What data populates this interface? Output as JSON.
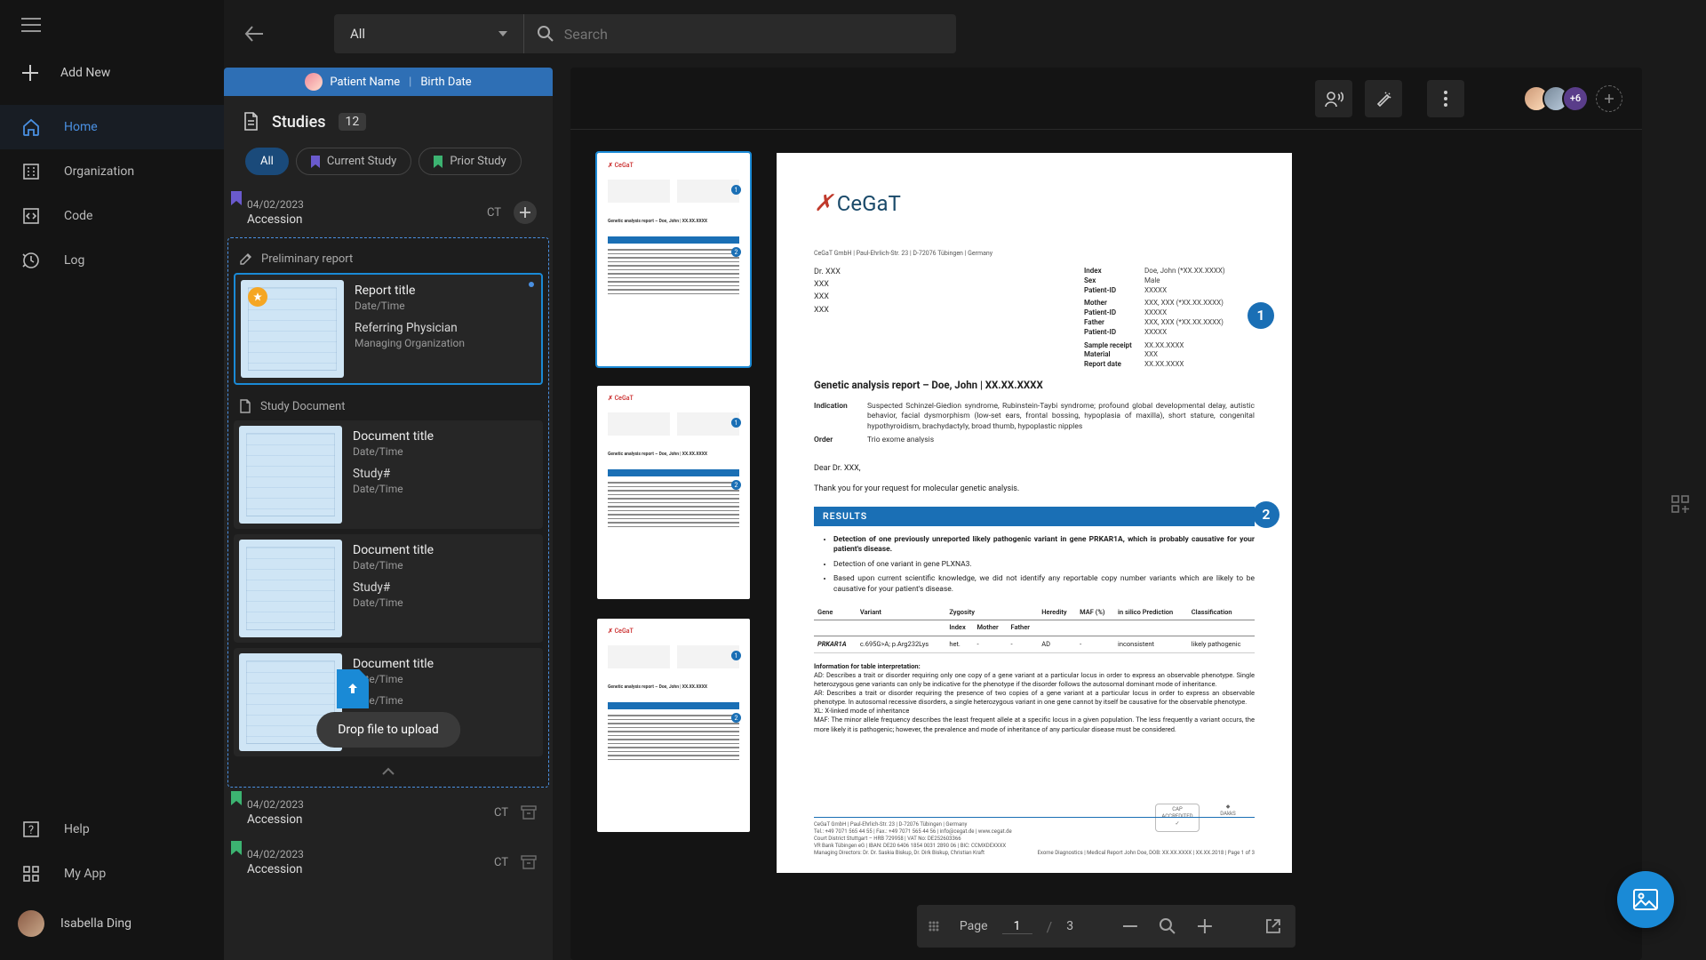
{
  "nav": {
    "add": "Add New",
    "items": [
      {
        "label": "Home",
        "icon": "home-icon",
        "active": true
      },
      {
        "label": "Organization",
        "icon": "organization-icon"
      },
      {
        "label": "Code",
        "icon": "code-icon"
      },
      {
        "label": "Log",
        "icon": "log-icon"
      }
    ],
    "bottom": [
      {
        "label": "Help",
        "icon": "help-icon"
      },
      {
        "label": "My App",
        "icon": "apps-icon"
      }
    ],
    "user": "Isabella Ding"
  },
  "search": {
    "dropdown": "All",
    "placeholder": "Search"
  },
  "patient": {
    "name": "Patient Name",
    "birth": "Birth Date"
  },
  "studies": {
    "title": "Studies",
    "count": "12",
    "filters": [
      {
        "label": "All",
        "active": true
      },
      {
        "label": "Current Study",
        "color": "#6a5acd"
      },
      {
        "label": "Prior Study",
        "color": "#3cb371"
      }
    ],
    "rows": [
      {
        "date": "04/02/2023",
        "accession": "Accession",
        "modality": "CT",
        "bookmark": "#6a5acd",
        "expand": "plus"
      },
      {
        "date": "04/02/2023",
        "accession": "Accession",
        "modality": "CT",
        "bookmark": "#3cb371",
        "expand": "archive"
      },
      {
        "date": "04/02/2023",
        "accession": "Accession",
        "modality": "CT",
        "bookmark": "#3cb371",
        "expand": "archive"
      }
    ],
    "sections": {
      "prelim": "Preliminary report",
      "studyDoc": "Study Document"
    },
    "cards": [
      {
        "title": "Report title",
        "sub": "Date/Time",
        "line3": "Referring Physician",
        "line4": "Managing Organization",
        "starred": true,
        "selected": true,
        "dot": true
      },
      {
        "title": "Document title",
        "sub": "Date/Time",
        "line3": "Study#",
        "line4": "Date/Time"
      },
      {
        "title": "Document title",
        "sub": "Date/Time",
        "line3": "Study#",
        "line4": "Date/Time"
      },
      {
        "title": "Document title",
        "sub": "Date/Time",
        "line3": "",
        "line4": "Date/Time"
      }
    ],
    "dropHint": "Drop file to upload"
  },
  "avatarsMore": "+6",
  "docControls": {
    "pageLabel": "Page",
    "current": "1",
    "total": "3"
  },
  "doc": {
    "logoText": "CeGaT",
    "address": "CeGaT GmbH | Paul-Ehrlich-Str. 23 | D-72076 Tübingen | Germany",
    "to": [
      "Dr. XXX",
      "XXX",
      "XXX",
      "XXX"
    ],
    "meta": [
      {
        "k": "Index",
        "v": "Doe, John (*XX.XX.XXXX)"
      },
      {
        "k": "Sex",
        "v": "Male"
      },
      {
        "k": "Patient-ID",
        "v": "XXXXX"
      },
      {
        "k": "Mother",
        "v": "XXX, XXX (*XX.XX.XXXX)"
      },
      {
        "k": "Patient-ID",
        "v": "XXXXX"
      },
      {
        "k": "Father",
        "v": "XXX, XXX (*XX.XX.XXXX)"
      },
      {
        "k": "Patient-ID",
        "v": "XXXXX"
      },
      {
        "k": "Sample receipt",
        "v": "XX.XX.XXXX"
      },
      {
        "k": "Material",
        "v": "XXX"
      },
      {
        "k": "Report date",
        "v": "XX.XX.XXXX"
      }
    ],
    "reportTitle": "Genetic analysis report – Doe, John | XX.XX.XXXX",
    "indicationLabel": "Indication",
    "indication": "Suspected Schinzel-Giedion syndrome, Rubinstein-Taybi syndrome; profound global developmental delay, autistic behavior, facial dysmorphism (low-set ears, frontal bossing, hypoplasia of maxilla), short stature, congenital hypothyroidism, brachydactyly, broad thumb, hypoplastic nipples",
    "orderLabel": "Order",
    "order": "Trio exome analysis",
    "salutation": "Dear Dr. XXX,",
    "intro": "Thank you for your request for molecular genetic analysis.",
    "resultsHeader": "RESULTS",
    "bullets": [
      "Detection of one previously unreported likely pathogenic variant in gene PRKAR1A, which is probably causative for your patient's disease.",
      "Detection of one variant in gene PLXNA3.",
      "Based upon current scientific knowledge, we did not identify any reportable copy number variants which are likely to be causative for your patient's disease."
    ],
    "tableHead": [
      "Gene",
      "Variant",
      "Zygosity",
      "Heredity",
      "MAF (%)",
      "in silico Prediction",
      "Classification"
    ],
    "tableSubHead": [
      "",
      "",
      "Index",
      "Mother",
      "Father",
      "",
      "",
      ""
    ],
    "tableRow": [
      "PRKAR1A",
      "c.695G>A; p.Arg232Lys",
      "het.",
      "-",
      "-",
      "AD",
      "-",
      "inconsistent",
      "likely pathogenic"
    ],
    "interpTitle": "Information for table interpretation:",
    "interpAD": "AD: Describes a trait or disorder requiring only one copy of a gene variant at a particular locus in order to express an observable phenotype. Single heterozygous gene variants can only be indicative for the phenotype if the disorder follows the autosomal dominant mode of inheritance.",
    "interpAR": "AR: Describes a trait or disorder requiring the presence of two copies of a gene variant at a particular locus in order to express an observable phenotype. In autosomal recessive disorders, a single heterozygous variant in one gene cannot by itself be causative for the observable phenotype.",
    "interpXL": "XL: X-linked mode of inheritance",
    "interpMAF": "MAF: The minor allele frequency describes the least frequent allele at a specific locus in a given population. The less frequently a variant occurs, the more likely it is pathogenic; however, the prevalence and mode of inheritance of any particular disease must be considered.",
    "footerLeft": "CeGaT GmbH | Paul-Ehrlich-Str. 23 | D-72076 Tübingen | Germany\nTel.: +49 7071 565 44 55 | Fax.: +49 7071 565 44 56 | info@cegat.de | www.cegat.de\nCourt District Stuttgart – HRB 729958 | VAT No: DE252603366\nVR Bank Tübingen eG | IBAN: DE20 6406 1854 0031 2890 06 | BIC: CCMXDEXXXX\nManaging Directors: Dr. Dr. Saskia Biskup, Dr. Dirk Biskup, Christian Kraft",
    "footerRight": "Exome Diagnostics | Medical Report John Doe, DOB: XX.XX.XXXX | XX.XX.2018 | Page 1 of 3",
    "capLabel": "CAP ACCREDITED",
    "dakksLabel": "DAkkS"
  }
}
